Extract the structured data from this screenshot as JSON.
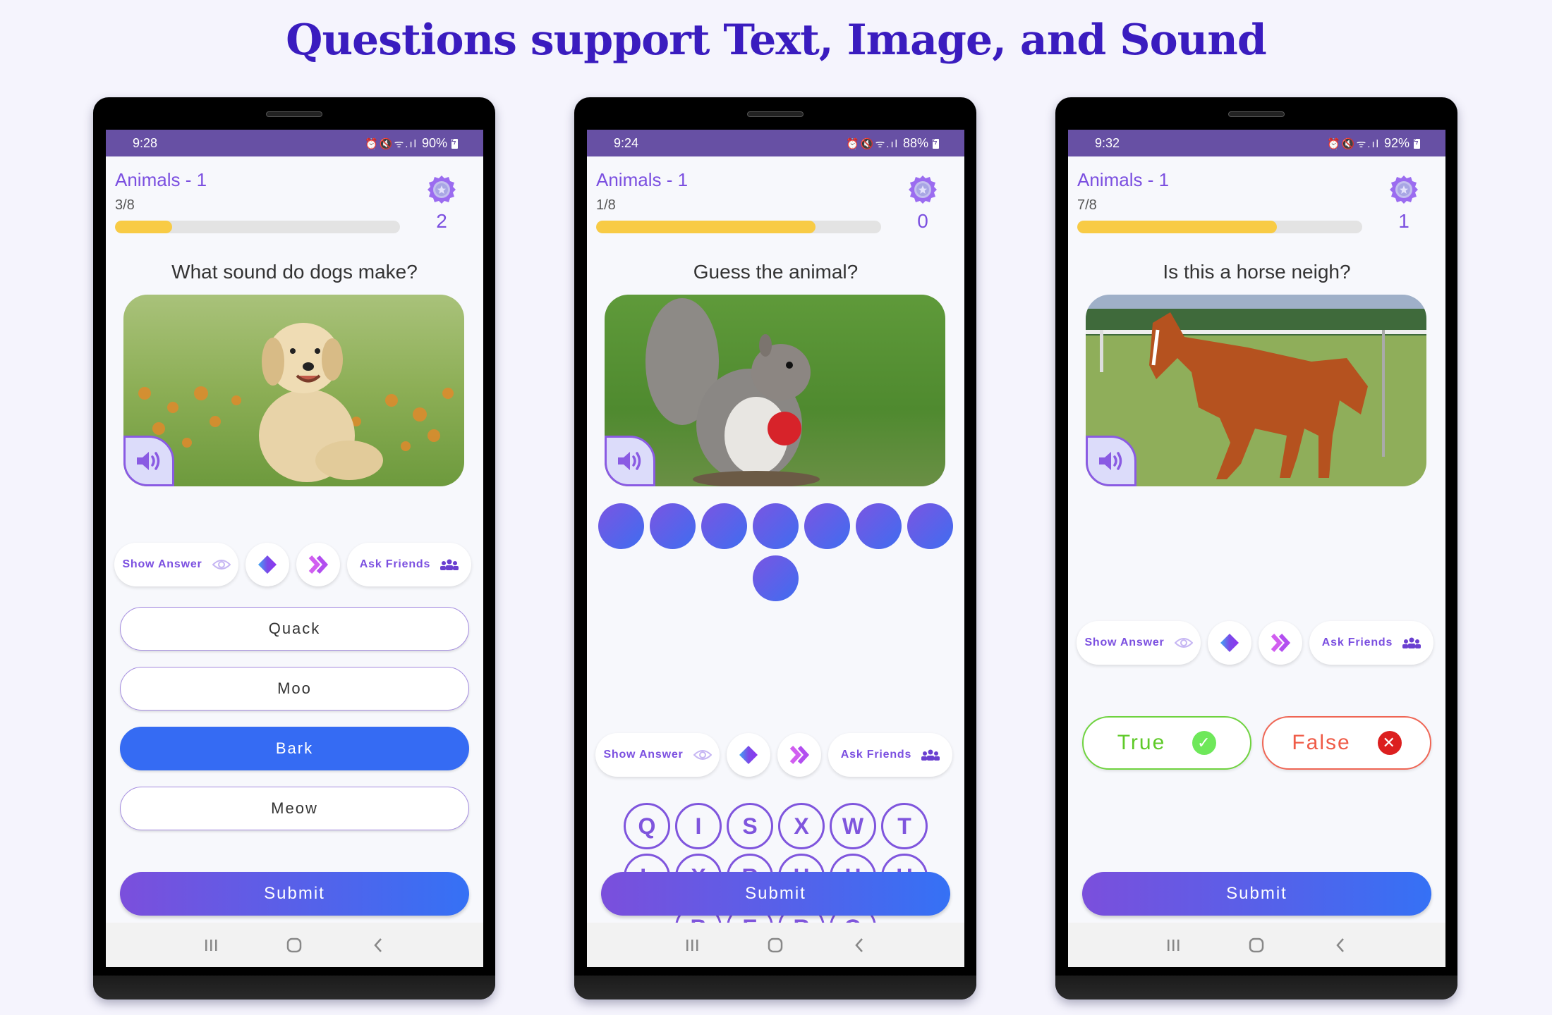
{
  "heading": "Questions support Text, Image, and Sound",
  "colors": {
    "status_bar": "#6750a4",
    "accent_purple": "#7b4fe0",
    "title_indigo": "#3a1cbf",
    "progress_fill": "#f8cb45",
    "selected_option": "#356bf3",
    "true_green": "#5fca29",
    "false_red": "#ef5b47"
  },
  "helpers": {
    "show_answer": "Show Answer",
    "ask_friends": "Ask Friends",
    "icons": [
      "eye-icon",
      "eraser-icon",
      "skip-icon",
      "group-icon"
    ]
  },
  "submit_label": "Submit",
  "phones": [
    {
      "status": {
        "time": "9:28",
        "battery": "90%"
      },
      "quiz_title": "Animals - 1",
      "progress_text": "3/8",
      "progress_fraction": 0.2,
      "score": "2",
      "question": "What sound do dogs make?",
      "image": "puppy",
      "type": "multiple-choice",
      "options": [
        {
          "label": "Quack",
          "selected": false
        },
        {
          "label": "Moo",
          "selected": false
        },
        {
          "label": "Bark",
          "selected": true
        },
        {
          "label": "Meow",
          "selected": false
        }
      ]
    },
    {
      "status": {
        "time": "9:24",
        "battery": "88%"
      },
      "quiz_title": "Animals - 1",
      "progress_text": "1/8",
      "progress_fraction": 0.77,
      "score": "0",
      "question": "Guess the animal?",
      "image": "squirrel",
      "type": "word-puzzle",
      "answer_slots": 8,
      "letters": [
        "Q",
        "I",
        "S",
        "X",
        "W",
        "T",
        "L",
        "X",
        "R",
        "H",
        "H",
        "U",
        "B",
        "E",
        "R",
        "Q"
      ]
    },
    {
      "status": {
        "time": "9:32",
        "battery": "92%"
      },
      "quiz_title": "Animals - 1",
      "progress_text": "7/8",
      "progress_fraction": 0.7,
      "score": "1",
      "question": "Is this a horse neigh?",
      "image": "horse",
      "type": "true-false",
      "true_label": "True",
      "false_label": "False"
    }
  ]
}
